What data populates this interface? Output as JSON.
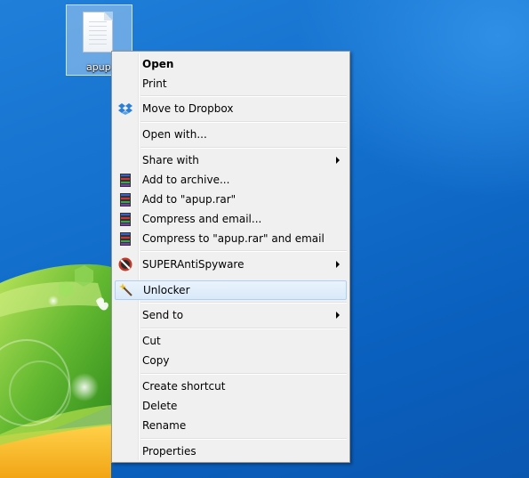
{
  "desktop": {
    "file_name": "apup"
  },
  "menu": {
    "items": [
      {
        "label": "Open",
        "bold": true
      },
      {
        "label": "Print"
      },
      {
        "label": "Move to Dropbox",
        "icon": "dropbox-icon"
      },
      {
        "label": "Open with..."
      },
      {
        "label": "Share with",
        "submenu": true
      },
      {
        "label": "Add to archive...",
        "icon": "winrar-icon"
      },
      {
        "label": "Add to \"apup.rar\"",
        "icon": "winrar-icon"
      },
      {
        "label": "Compress and email...",
        "icon": "winrar-icon"
      },
      {
        "label": "Compress to \"apup.rar\" and email",
        "icon": "winrar-icon"
      },
      {
        "label": "SUPERAntiSpyware",
        "icon": "superantispyware-icon",
        "submenu": true
      },
      {
        "label": "Unlocker",
        "icon": "unlocker-wand-icon",
        "highlighted": true
      },
      {
        "label": "Send to",
        "submenu": true
      },
      {
        "label": "Cut"
      },
      {
        "label": "Copy"
      },
      {
        "label": "Create shortcut"
      },
      {
        "label": "Delete"
      },
      {
        "label": "Rename"
      },
      {
        "label": "Properties"
      }
    ]
  },
  "colors": {
    "desktop_blue": "#136fcc",
    "menu_background": "#f0f0f0",
    "highlight_border": "#aecff7"
  }
}
